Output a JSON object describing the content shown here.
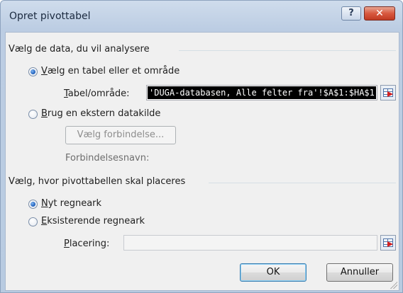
{
  "window": {
    "title": "Opret pivottabel",
    "help_label": "?",
    "close_label": "✕"
  },
  "data_section": {
    "heading": "Vælg de data, du vil analysere",
    "option_table": {
      "prefix": "",
      "mnemonic": "V",
      "rest": "ælg en tabel eller et område",
      "selected": true
    },
    "table_field": {
      "label_mnemonic": "T",
      "label_rest": "abel/område:",
      "value": "'DUGA-databasen, Alle felter fra'!$A$1:$HA$1"
    },
    "option_external": {
      "mnemonic": "B",
      "rest": "rug en ekstern datakilde",
      "selected": false
    },
    "choose_connection_button": "Vælg forbindelse...",
    "connection_name_label": "Forbindelsesnavn:"
  },
  "placement_section": {
    "heading": "Vælg, hvor pivottabellen skal placeres",
    "option_new": {
      "mnemonic": "N",
      "rest": "yt regneark",
      "selected": true
    },
    "option_existing": {
      "mnemonic": "E",
      "rest": "ksisterende regneark",
      "selected": false
    },
    "location_field": {
      "label_mnemonic": "P",
      "label_rest": "lacering:",
      "value": ""
    }
  },
  "buttons": {
    "ok": "OK",
    "cancel": "Annuller"
  },
  "colors": {
    "selection_bg": "#000000",
    "radio_dot": "#1b5cb8",
    "close_button": "#c8472f"
  }
}
